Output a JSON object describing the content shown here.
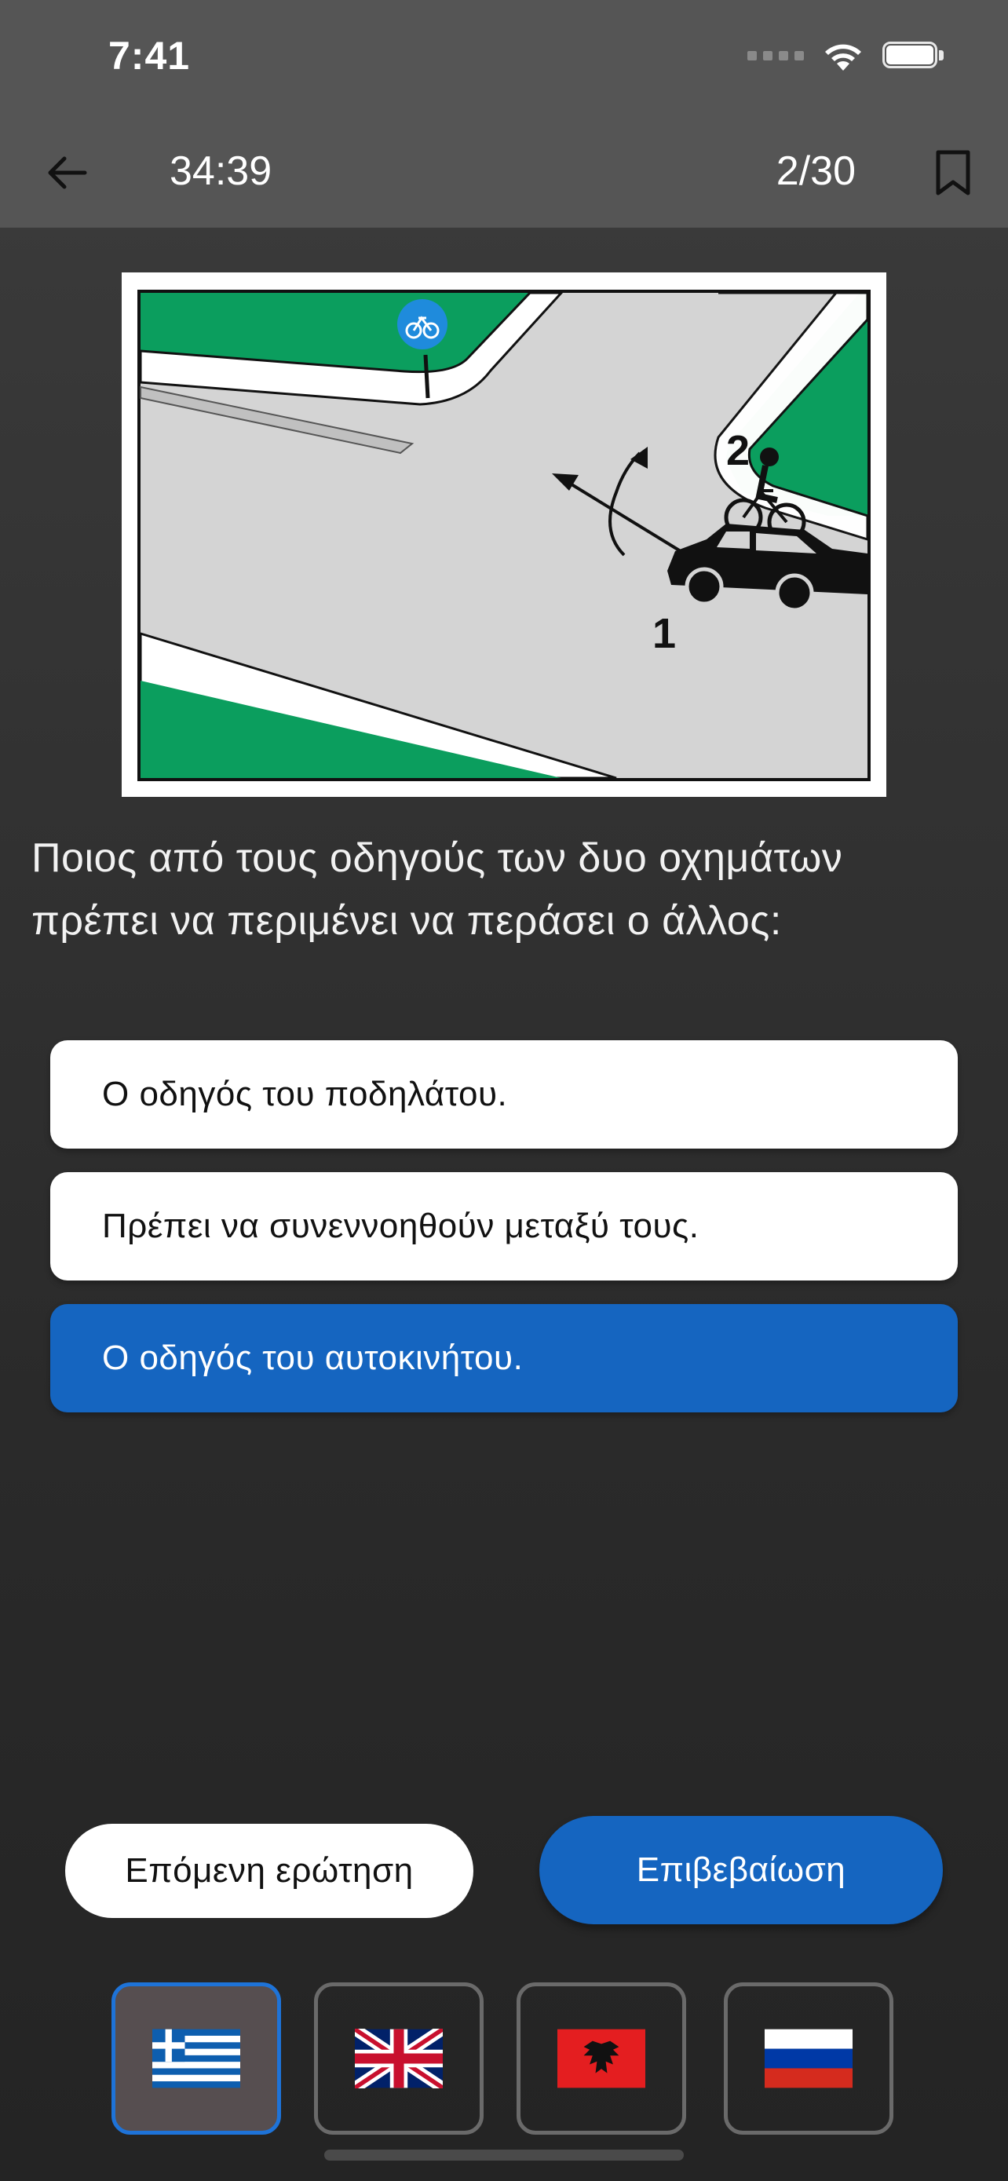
{
  "status": {
    "time": "7:41"
  },
  "header": {
    "timer": "34:39",
    "progress": "2/30"
  },
  "figure": {
    "label_car": "1",
    "label_bike": "2"
  },
  "question": {
    "text": "Ποιος από τους οδηγούς των δυο οχημάτων πρέπει να περιμένει να περάσει ο άλλος:"
  },
  "answers": [
    {
      "text": "Ο οδηγός του ποδηλάτου.",
      "selected": false
    },
    {
      "text": "Πρέπει να συνεννοηθούν μεταξύ τους.",
      "selected": false
    },
    {
      "text": "Ο οδηγός του αυτοκινήτου.",
      "selected": true
    }
  ],
  "actions": {
    "next_label": "Επόμενη ερώτηση",
    "confirm_label": "Επιβεβαίωση"
  },
  "languages": [
    {
      "icon": "greece-flag-icon",
      "active": true
    },
    {
      "icon": "uk-flag-icon",
      "active": false
    },
    {
      "icon": "albania-flag-icon",
      "active": false
    },
    {
      "icon": "russia-flag-icon",
      "active": false
    }
  ],
  "colors": {
    "accent": "#1565c0",
    "bar": "#555555",
    "road": "#d4d4d4",
    "grass": "#0b9e5e"
  }
}
